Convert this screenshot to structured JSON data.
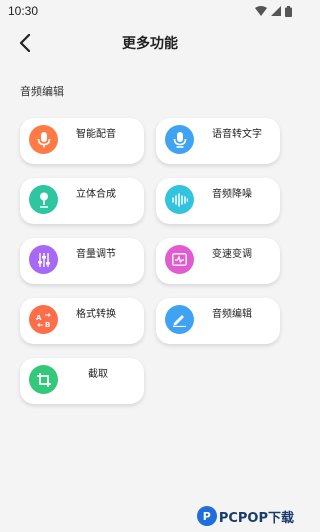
{
  "status_bar": {
    "time": "10:30"
  },
  "header": {
    "title": "更多功能",
    "back_icon": "chevron-left-icon"
  },
  "section": {
    "title": "音频编辑"
  },
  "features": [
    {
      "label": "智能配音",
      "icon": "microphone-icon",
      "color": "#FF7A45"
    },
    {
      "label": "语音转文字",
      "icon": "microphone-icon",
      "color": "#3FA3F2"
    },
    {
      "label": "立体合成",
      "icon": "microphone-stand-icon",
      "color": "#2DC6A0"
    },
    {
      "label": "音频降噪",
      "icon": "waveform-icon",
      "color": "#33C3DE"
    },
    {
      "label": "音量调节",
      "icon": "sliders-icon",
      "color": "#A768F5"
    },
    {
      "label": "变速变调",
      "icon": "pulse-monitor-icon",
      "color": "#E25BD0"
    },
    {
      "label": "格式转换",
      "icon": "a-to-b-icon",
      "color": "#FF6E4A"
    },
    {
      "label": "音频编辑",
      "icon": "pencil-icon",
      "color": "#3FA3F2"
    },
    {
      "label": "截取",
      "icon": "crop-icon",
      "color": "#33C97A"
    }
  ],
  "watermark": {
    "text": "PCPOP下载"
  }
}
